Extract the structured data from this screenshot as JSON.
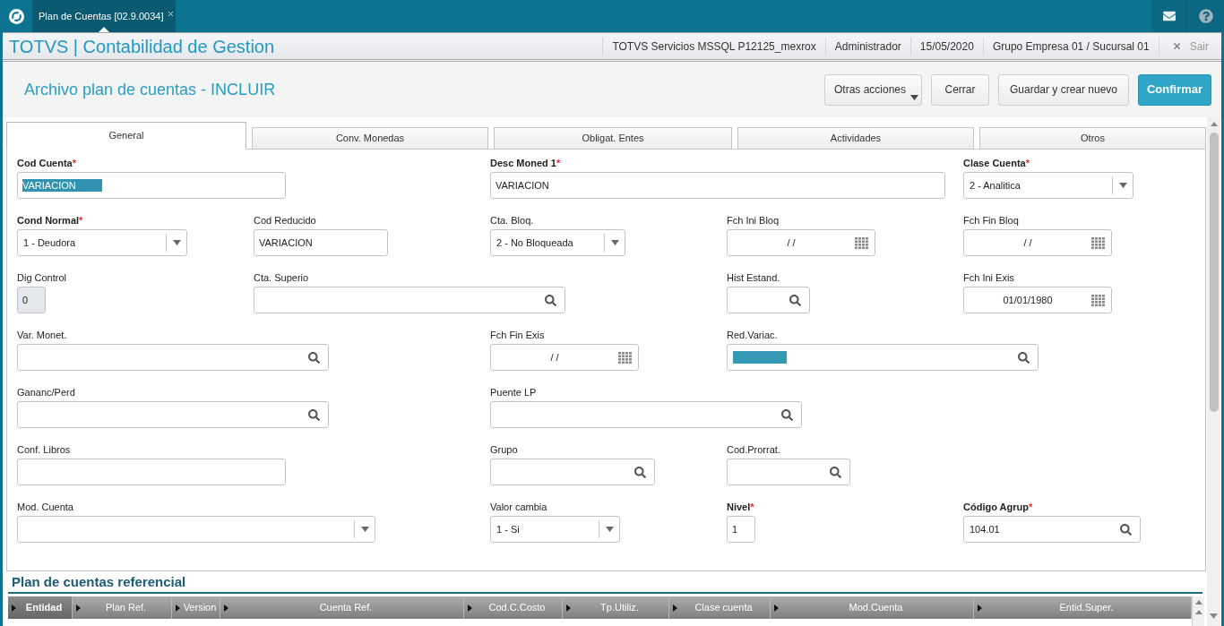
{
  "top_bar": {
    "tabs": [
      {
        "title": "Plan de Cuentas [02.9.0034]",
        "selected": true
      }
    ]
  },
  "header": {
    "product": "TOTVS | Contabilidad de Gestion",
    "info": [
      "TOTVS Servicios MSSQL P12125_mexrox",
      "Administrador",
      "15/05/2020",
      "Grupo Empresa 01 / Sucursal 01"
    ],
    "logout": "Sair"
  },
  "action_bar": {
    "title": "Archivo plan de cuentas - INCLUIR",
    "buttons": [
      {
        "label": "Otras acciones",
        "kind": "menu"
      },
      {
        "label": "Cerrar",
        "kind": "default"
      },
      {
        "label": "Guardar y crear nuevo",
        "kind": "default"
      },
      {
        "label": "Confirmar",
        "kind": "primary"
      }
    ]
  },
  "tabs": [
    {
      "label": "General",
      "selected": true
    },
    {
      "label": "Conv. Monedas",
      "selected": false
    },
    {
      "label": "Obligat. Entes",
      "selected": false
    },
    {
      "label": "Actividades",
      "selected": false
    },
    {
      "label": "Otros",
      "selected": false
    }
  ],
  "form": {
    "rows": [
      [
        {
          "label": "Cod Cuenta",
          "required_mark": "*",
          "kind": "text",
          "value": "VARIACION",
          "highlighted": true,
          "disabled": false
        },
        "",
        {
          "label": "Desc Moned 1",
          "required_mark": "*",
          "kind": "text",
          "value": "VARIACION",
          "highlighted": false,
          "disabled": false
        },
        "",
        {
          "label": "Clase Cuenta",
          "required_mark": "*",
          "kind": "select",
          "value": "2 - Analitica",
          "highlighted": false,
          "disabled": false
        }
      ],
      [
        {
          "label": "Cond Normal",
          "required_mark": "*",
          "kind": "select",
          "value": "1 - Deudora",
          "highlighted": false,
          "disabled": false
        },
        {
          "label": "Cod Reducido",
          "kind": "text",
          "value": "VARIACION",
          "highlighted": false,
          "disabled": false
        },
        {
          "label": "Cta. Bloq.",
          "kind": "select",
          "value": "2 - No Bloqueada",
          "highlighted": false,
          "disabled": false
        },
        {
          "label": "Fch Ini Bloq",
          "kind": "date",
          "value": "/ /",
          "highlighted": false,
          "disabled": false
        },
        {
          "label": "Fch Fin Bloq",
          "kind": "date",
          "value": "/ /",
          "highlighted": false,
          "disabled": false
        }
      ],
      [
        {
          "label": "Dig Control",
          "kind": "text",
          "value": "0",
          "highlighted": false,
          "disabled": true
        },
        {
          "label": "Cta. Superio",
          "kind": "search",
          "highlighted": false,
          "disabled": false
        },
        "",
        {
          "label": "Hist Estand.",
          "kind": "search",
          "highlighted": false,
          "disabled": false
        },
        {
          "label": "Fch Ini Exis",
          "kind": "date",
          "value": "01/01/1980",
          "highlighted": false,
          "disabled": false
        }
      ],
      [
        {
          "label": "Var. Monet.",
          "kind": "search",
          "highlighted": false,
          "disabled": false
        },
        "",
        {
          "label": "Fch Fin Exis",
          "kind": "date",
          "value": "/ /",
          "highlighted": false,
          "disabled": false
        },
        {
          "label": "Red.Variac.",
          "kind": "search",
          "highlighted": true,
          "disabled": false
        }
      ],
      [
        {
          "label": "Gananc/Perd",
          "kind": "search",
          "highlighted": false,
          "disabled": false
        },
        "",
        {
          "label": "Puente LP",
          "kind": "search",
          "highlighted": false,
          "disabled": false
        }
      ],
      [
        {
          "label": "Conf. Libros",
          "kind": "text",
          "highlighted": false,
          "disabled": false
        },
        "",
        {
          "label": "Grupo",
          "kind": "search",
          "highlighted": false,
          "disabled": false
        },
        {
          "label": "Cod.Prorrat.",
          "kind": "search",
          "highlighted": false,
          "disabled": false
        }
      ],
      [
        {
          "label": "Mod. Cuenta",
          "kind": "select",
          "highlighted": false,
          "disabled": false
        },
        "",
        {
          "label": "Valor cambia",
          "kind": "select",
          "value": "1 - Si",
          "highlighted": false,
          "disabled": false
        },
        {
          "label": "Nivel",
          "required_mark": "*",
          "kind": "text",
          "value": "1",
          "highlighted": false,
          "disabled": false
        },
        {
          "label": "Código Agrup",
          "required_mark": "*",
          "kind": "search",
          "value": "104.01",
          "highlighted": false,
          "disabled": false
        }
      ]
    ]
  },
  "referential": {
    "title": "Plan de cuentas referencial",
    "columns": [
      {
        "label": "Entidad",
        "selected": true
      },
      {
        "label": "Plan Ref.",
        "selected": false
      },
      {
        "label": "Version",
        "selected": false
      },
      {
        "label": "Cuenta Ref.",
        "selected": false
      },
      {
        "label": "Cod.C.Costo",
        "selected": false
      },
      {
        "label": "Tp.Utiliz.",
        "selected": false
      },
      {
        "label": "Clase cuenta",
        "selected": false
      },
      {
        "label": "Mod.Cuenta",
        "selected": false
      },
      {
        "label": "Entid.Super.",
        "selected": false
      }
    ]
  }
}
